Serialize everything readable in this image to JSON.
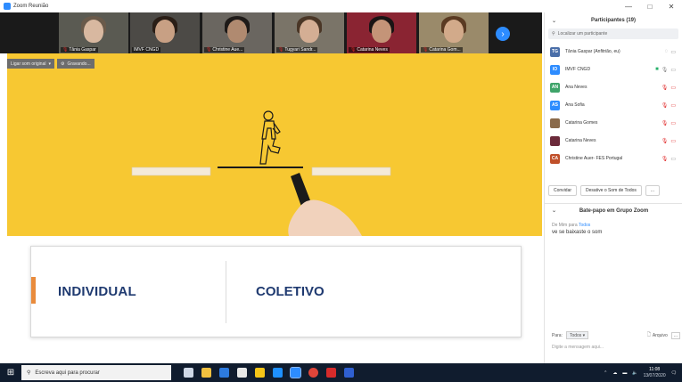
{
  "window": {
    "title": "Zoom Reunião",
    "controls": [
      "—",
      "□",
      "✕"
    ]
  },
  "video_tiles": [
    {
      "name": "Tânia Gaspar"
    },
    {
      "name": "IMVF CNGD"
    },
    {
      "name": "Christine Aue..."
    },
    {
      "name": "Tugyari Sandr..."
    },
    {
      "name": "Catarina Neves"
    },
    {
      "name": "Catarina Gom..."
    }
  ],
  "share_toolbar": {
    "sound_label": "Ligar som original",
    "saving_label": "Gravando..."
  },
  "slide": {
    "left_label": "INDIVIDUAL",
    "right_label": "COLETIVO"
  },
  "participants": {
    "title": "Participantes (19)",
    "search_placeholder": "Localizar um participante",
    "items": [
      {
        "initials": "TG",
        "name": "Tânia Gaspar  (Anfitrião, eu)",
        "color": "#4a6ea8"
      },
      {
        "initials": "IO",
        "name": "IMVF CNGD",
        "color": "#2d8cff"
      },
      {
        "initials": "AN",
        "name": "Ana Neves",
        "color": "#3fa46a"
      },
      {
        "initials": "AS",
        "name": "Ana Sofia",
        "color": "#2d8cff"
      },
      {
        "initials": "",
        "name": "Catarina Gomes",
        "color": "#8a6a4a"
      },
      {
        "initials": "",
        "name": "Catarina Neves",
        "color": "#6b2a3a"
      },
      {
        "initials": "CA",
        "name": "Christine Auer- FES Portugal",
        "color": "#c0502a"
      }
    ],
    "invite_label": "Convidar",
    "mute_all_label": "Desative o Som de Todos",
    "more_label": "..."
  },
  "chat": {
    "title": "Bate-papo em Grupo Zoom",
    "from_line": "De Mim para",
    "to_line": "Todos",
    "message": "ve se baixaste o som",
    "to_label": "Para:",
    "to_select": "Todos ▾",
    "file_label": "Arquivo",
    "more_label": "...",
    "input_placeholder": "Digite a mensagem aqui..."
  },
  "taskbar": {
    "search_placeholder": "Escreva aqui para procurar",
    "time": "11:08",
    "date": "13/07/2020"
  }
}
